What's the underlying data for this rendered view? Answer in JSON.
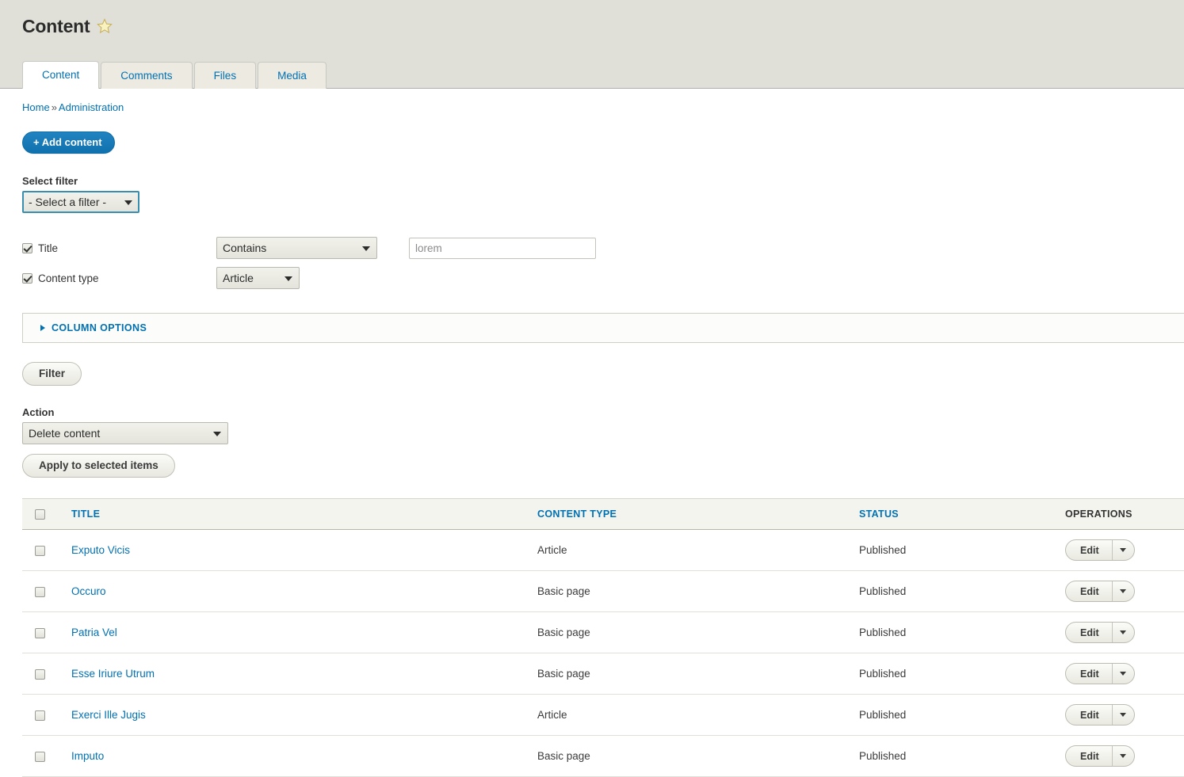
{
  "header": {
    "title": "Content",
    "star_icon": "star-icon",
    "tabs": [
      {
        "label": "Content",
        "active": true
      },
      {
        "label": "Comments",
        "active": false
      },
      {
        "label": "Files",
        "active": false
      },
      {
        "label": "Media",
        "active": false
      }
    ]
  },
  "breadcrumb": {
    "items": [
      "Home",
      "Administration"
    ],
    "separator": "»"
  },
  "actions": {
    "add_content_label": "+ Add content"
  },
  "filters": {
    "select_filter_label": "Select filter",
    "select_filter_value": "- Select a filter -",
    "select_filter_options": [
      "- Select a filter -"
    ],
    "rows": [
      {
        "checkbox_label": "Title",
        "checked": true,
        "operator_value": "Contains",
        "operator_options": [
          "Contains"
        ],
        "text_value": "lorem",
        "text_placeholder": "lorem"
      },
      {
        "checkbox_label": "Content type",
        "checked": true,
        "operator_value": "Article",
        "operator_options": [
          "Article"
        ]
      }
    ],
    "column_options_label": "COLUMN OPTIONS",
    "filter_button_label": "Filter"
  },
  "action_area": {
    "label": "Action",
    "selected": "Delete content",
    "options": [
      "Delete content"
    ],
    "apply_button_label": "Apply to selected items"
  },
  "table": {
    "columns": {
      "title": "TITLE",
      "content_type": "CONTENT TYPE",
      "status": "STATUS",
      "operations": "OPERATIONS"
    },
    "rows": [
      {
        "title": "Exputo Vicis",
        "content_type": "Article",
        "status": "Published",
        "edit_label": "Edit"
      },
      {
        "title": "Occuro",
        "content_type": "Basic page",
        "status": "Published",
        "edit_label": "Edit"
      },
      {
        "title": "Patria Vel",
        "content_type": "Basic page",
        "status": "Published",
        "edit_label": "Edit"
      },
      {
        "title": "Esse Iriure Utrum",
        "content_type": "Basic page",
        "status": "Published",
        "edit_label": "Edit"
      },
      {
        "title": "Exerci Ille Jugis",
        "content_type": "Article",
        "status": "Published",
        "edit_label": "Edit"
      },
      {
        "title": "Imputo",
        "content_type": "Basic page",
        "status": "Published",
        "edit_label": "Edit"
      }
    ]
  },
  "colors": {
    "link": "#0071b3",
    "primary_button": "#1278b5",
    "header_band": "#e0e0d8",
    "table_header_bg": "#f3f4ee",
    "star_fill": "#f7f2c0",
    "star_stroke": "#c6ad56"
  }
}
